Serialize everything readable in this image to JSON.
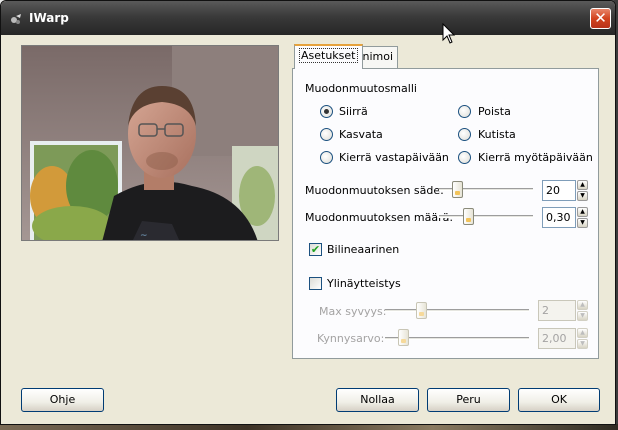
{
  "window": {
    "title": "IWarp"
  },
  "tabs": [
    {
      "label": "Asetukset",
      "active": true
    },
    {
      "label": "Animoi",
      "active": false
    }
  ],
  "deform_mode": {
    "title": "Muodonmuutosmalli",
    "options": [
      {
        "label": "Siirrä",
        "checked": true
      },
      {
        "label": "Poista",
        "checked": false
      },
      {
        "label": "Kasvata",
        "checked": false
      },
      {
        "label": "Kutista",
        "checked": false
      },
      {
        "label": "Kierrä vastapäivään",
        "checked": false
      },
      {
        "label": "Kierrä myötäpäivään",
        "checked": false
      }
    ]
  },
  "deform_radius": {
    "label": "Muodonmuutoksen säde:",
    "value": "20"
  },
  "deform_amount": {
    "label": "Muodonmuutoksen määrä:",
    "value": "0,30"
  },
  "bilinear": {
    "label": "Bilineaarinen",
    "checked": true
  },
  "supersampling": {
    "label": "Ylinäytteistys",
    "checked": false
  },
  "max_depth": {
    "label": "Max syvyys:",
    "value": "2"
  },
  "threshold": {
    "label": "Kynnysarvo:",
    "value": "2,00"
  },
  "buttons": {
    "help": "Ohje",
    "reset": "Nollaa",
    "cancel": "Peru",
    "ok": "OK"
  },
  "colors": {
    "titlebar": "#2e2e2e",
    "dialog_bg": "#ece9d8",
    "close": "#d2431e",
    "tab_highlight": "#e6a23c"
  },
  "icons": [
    "app-icon",
    "close-icon",
    "mouse-cursor-icon",
    "spin-up-icon",
    "spin-down-icon",
    "checkmark-icon"
  ]
}
